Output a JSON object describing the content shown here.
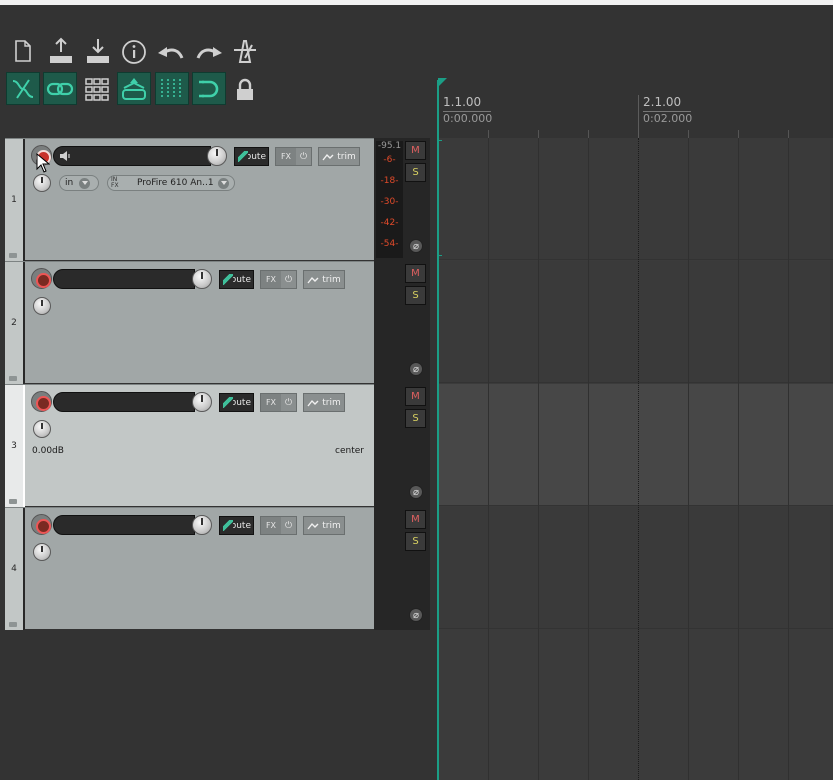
{
  "toolbar": {
    "row1": [
      "new-project-icon",
      "save-project-icon",
      "open-project-icon",
      "project-info-icon",
      "undo-icon",
      "redo-icon",
      "metronome-icon"
    ],
    "row2": [
      "ripple-edit-icon",
      "item-grouping-icon",
      "snap-grid-icon",
      "envelope-lock-icon",
      "grid-lines-icon",
      "loop-icon",
      "lock-icon"
    ]
  },
  "ruler": {
    "markers": [
      {
        "bar": "1.1.00",
        "time": "0:00.000"
      },
      {
        "bar": "2.1.00",
        "time": "0:02.000"
      }
    ]
  },
  "tracks": [
    {
      "number": "1",
      "route": "Route",
      "fx": "FX",
      "power": "⏻",
      "trim": "trim",
      "input_mode": "in",
      "fx_chain_label": "IN FX",
      "input_device": "ProFire 610 An..1",
      "armed": true
    },
    {
      "number": "2",
      "route": "Route",
      "fx": "FX",
      "power": "⏻",
      "trim": "trim"
    },
    {
      "number": "3",
      "route": "Route",
      "fx": "FX",
      "power": "⏻",
      "trim": "trim",
      "volume": "0.00dB",
      "pan": "center",
      "selected": true
    },
    {
      "number": "4",
      "route": "Route",
      "fx": "FX",
      "power": "⏻",
      "trim": "trim"
    }
  ],
  "meter": {
    "peak": "-95.1",
    "scale": [
      "-6-",
      "-18-",
      "-30-",
      "-42-",
      "-54-"
    ]
  },
  "mute_label": "M",
  "solo_label": "S",
  "phase_symbol": "⌀",
  "colors": {
    "accent": "#1b9e86",
    "armed_red": "#c8322a",
    "meter_text": "#e04a2a"
  }
}
